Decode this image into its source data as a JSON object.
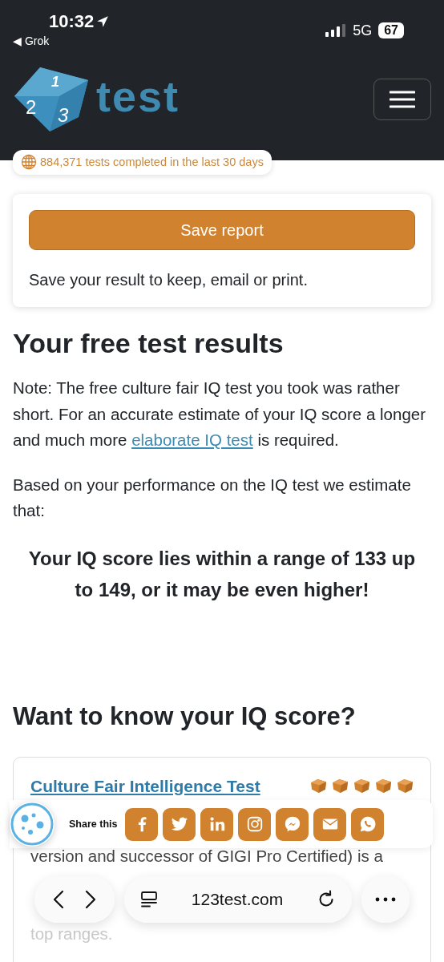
{
  "status_bar": {
    "time": "10:32",
    "back_app": "◀ Grok",
    "network": "5G",
    "battery": "67"
  },
  "header": {
    "logo": {
      "digits": [
        "1",
        "2",
        "3"
      ],
      "text": "test"
    }
  },
  "counter_badge": "884,371 tests completed in the last 30 days",
  "save_card": {
    "button": "Save report",
    "text": "Save your result to keep, email or print."
  },
  "results": {
    "heading": "Your free test results",
    "note": {
      "before": "Note: The free culture fair IQ test you took was rather short. For an accurate estimate of your IQ score a longer and much more ",
      "link": "elaborate IQ test",
      "after": " is required."
    },
    "basis": "Based on your performance on the IQ test we estimate that:",
    "score": "Your IQ score lies within a range of 133 up to 149, or it may be even higher!"
  },
  "more": {
    "heading": "Want to know your IQ score?",
    "card": {
      "title": "Culture Fair Intelligence Test",
      "stars": 5,
      "lines": [
        "version and successor of GIGI Pro Certified) is a",
        "top ranges."
      ]
    }
  },
  "share_bar": {
    "label": "Share this",
    "buttons": [
      {
        "kind": "facebook"
      },
      {
        "kind": "twitter"
      },
      {
        "kind": "linkedin"
      },
      {
        "kind": "instagram"
      },
      {
        "kind": "messenger"
      },
      {
        "kind": "email"
      },
      {
        "kind": "whatsapp"
      }
    ]
  },
  "browser_bar": {
    "url": "123test.com"
  }
}
